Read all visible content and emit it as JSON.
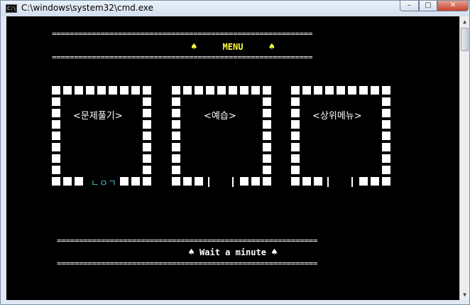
{
  "window": {
    "title": "C:\\windows\\system32\\cmd.exe",
    "icon": "cmd-icon",
    "controls": {
      "minimize": "–",
      "maximize": "□",
      "close": "✕"
    }
  },
  "console": {
    "separator": "===========================================================",
    "menu": {
      "left_symbol": "♠",
      "title": "MENU",
      "right_symbol": "♠",
      "color": "#ffff3c"
    },
    "boxes": [
      {
        "label": "<문제풀기>",
        "bottom_glyph": "ㄴㅇㄱ",
        "glyph_color": "#3fc7d0"
      },
      {
        "label": "<예습>"
      },
      {
        "label": "<상위메뉴>"
      }
    ],
    "footer": {
      "left_symbol": "♠",
      "text": "Wait a minute",
      "right_symbol": "♠"
    }
  }
}
